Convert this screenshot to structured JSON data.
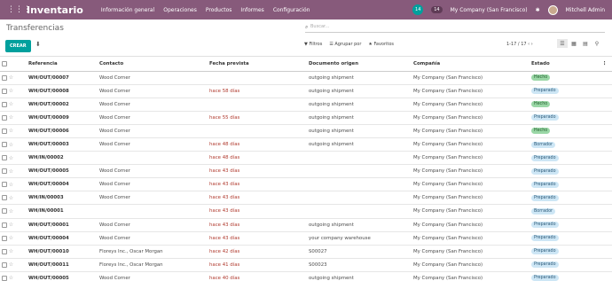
{
  "topbar": {
    "app_name": "Inventario",
    "menu": [
      "Información general",
      "Operaciones",
      "Productos",
      "Informes",
      "Configuración"
    ],
    "chat_count": "14",
    "company_count": "14",
    "company": "My Company (San Francisco)",
    "user": "Mitchell Admin",
    "icons": [
      "apps-icon",
      "chat-icon",
      "activity-icon",
      "settings-icon",
      "avatar"
    ]
  },
  "control": {
    "breadcrumb": "Transferencias",
    "search_placeholder": "Buscar...",
    "create_label": "CREAR",
    "filters_label": "Filtros",
    "group_label": "Agrupar por",
    "favorites_label": "Favoritos",
    "pager": "1-17 / 17"
  },
  "table": {
    "headers": [
      "Referencia",
      "Contacto",
      "Fecha prevista",
      "Documento origen",
      "Compañía",
      "Estado"
    ],
    "rows": [
      {
        "ref": "WH/OUT/00007",
        "contact": "Wood Corner",
        "date": "",
        "origin": "outgoing shipment",
        "company": "My Company (San Francisco)",
        "state": "Hecho",
        "state_type": "done"
      },
      {
        "ref": "WH/OUT/00008",
        "contact": "Wood Corner",
        "date": "hace 58 días",
        "origin": "outgoing shipment",
        "company": "My Company (San Francisco)",
        "state": "Preparado",
        "state_type": "ready"
      },
      {
        "ref": "WH/OUT/00002",
        "contact": "Wood Corner",
        "date": "",
        "origin": "outgoing shipment",
        "company": "My Company (San Francisco)",
        "state": "Hecho",
        "state_type": "done"
      },
      {
        "ref": "WH/OUT/00009",
        "contact": "Wood Corner",
        "date": "hace 55 días",
        "origin": "outgoing shipment",
        "company": "My Company (San Francisco)",
        "state": "Preparado",
        "state_type": "ready"
      },
      {
        "ref": "WH/OUT/00006",
        "contact": "Wood Corner",
        "date": "",
        "origin": "outgoing shipment",
        "company": "My Company (San Francisco)",
        "state": "Hecho",
        "state_type": "done"
      },
      {
        "ref": "WH/OUT/00003",
        "contact": "Wood Corner",
        "date": "hace 48 días",
        "origin": "outgoing shipment",
        "company": "My Company (San Francisco)",
        "state": "Borrador",
        "state_type": "ready"
      },
      {
        "ref": "WH/IN/00002",
        "contact": "",
        "date": "hace 48 días",
        "origin": "",
        "company": "My Company (San Francisco)",
        "state": "Preparado",
        "state_type": "ready"
      },
      {
        "ref": "WH/OUT/00005",
        "contact": "Wood Corner",
        "date": "hace 43 días",
        "origin": "",
        "company": "My Company (San Francisco)",
        "state": "Preparado",
        "state_type": "ready"
      },
      {
        "ref": "WH/OUT/00004",
        "contact": "Wood Corner",
        "date": "hace 43 días",
        "origin": "",
        "company": "My Company (San Francisco)",
        "state": "Preparado",
        "state_type": "ready"
      },
      {
        "ref": "WH/IN/00003",
        "contact": "Wood Corner",
        "date": "hace 43 días",
        "origin": "",
        "company": "My Company (San Francisco)",
        "state": "Preparado",
        "state_type": "ready"
      },
      {
        "ref": "WH/IN/00001",
        "contact": "",
        "date": "hace 43 días",
        "origin": "",
        "company": "My Company (San Francisco)",
        "state": "Borrador",
        "state_type": "ready"
      },
      {
        "ref": "WH/OUT/00001",
        "contact": "Wood Corner",
        "date": "hace 43 días",
        "origin": "outgoing shipment",
        "company": "My Company (San Francisco)",
        "state": "Preparado",
        "state_type": "ready"
      },
      {
        "ref": "WH/OUT/00004",
        "contact": "Wood Corner",
        "date": "hace 43 días",
        "origin": "your company warehouse",
        "company": "My Company (San Francisco)",
        "state": "Preparado",
        "state_type": "ready"
      },
      {
        "ref": "WH/OUT/00010",
        "contact": "Floreys Inc., Oscar Morgan",
        "date": "hace 42 días",
        "origin": "S00027",
        "company": "My Company (San Francisco)",
        "state": "Preparado",
        "state_type": "ready"
      },
      {
        "ref": "WH/OUT/00011",
        "contact": "Floreys Inc., Oscar Morgan",
        "date": "hace 41 días",
        "origin": "S00023",
        "company": "My Company (San Francisco)",
        "state": "Preparado",
        "state_type": "ready"
      },
      {
        "ref": "WH/OUT/00005",
        "contact": "Wood Corner",
        "date": "hace 40 días",
        "origin": "outgoing shipment",
        "company": "My Company (San Francisco)",
        "state": "Preparado",
        "state_type": "ready"
      }
    ]
  }
}
